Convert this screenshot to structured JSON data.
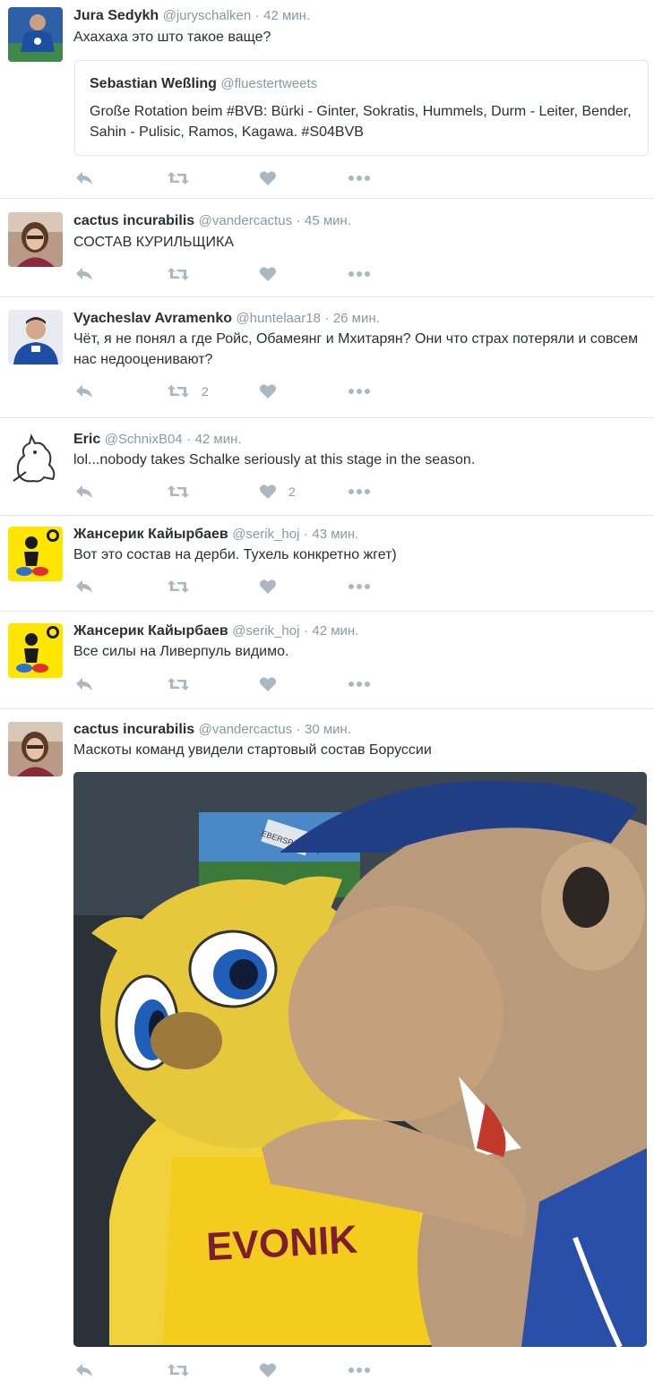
{
  "tweets": [
    {
      "fullname": "Jura Sedykh",
      "handle": "@juryschalken",
      "sep": "·",
      "time": "42 мин.",
      "text": "Ахахаха это што такое ваще?",
      "quote": {
        "fullname": "Sebastian Weßling",
        "handle": "@fluestertweets",
        "text": "Große Rotation beim #BVB: Bürki - Ginter, Sokratis, Hummels, Durm - Leiter, Bender, Sahin - Pulisic, Ramos, Kagawa. #S04BVB"
      },
      "retweets": "",
      "likes": ""
    },
    {
      "fullname": "cactus incurabilis",
      "handle": "@vandercactus",
      "sep": "·",
      "time": "45 мин.",
      "text": "СОСТАВ КУРИЛЬЩИКА",
      "retweets": "",
      "likes": ""
    },
    {
      "fullname": "Vyacheslav Avramenko",
      "handle": "@huntelaar18",
      "sep": "·",
      "time": "26 мин.",
      "text": "Чёт, я не понял а где Ройс, Обамеянг и Мхитарян? Они что страх потеряли и совсем нас недооценивают?",
      "retweets": "2",
      "likes": ""
    },
    {
      "fullname": "Eric",
      "handle": "@SchnixB04",
      "sep": "·",
      "time": "42 мин.",
      "text": "lol...nobody takes Schalke seriously at this stage in the season.",
      "retweets": "",
      "likes": "2"
    },
    {
      "fullname": "Жансерик Кайырбаев",
      "handle": "@serik_hoj",
      "sep": "·",
      "time": "43 мин.",
      "text": "Вот это состав на дерби. Тухель конкретно жгет)",
      "retweets": "",
      "likes": ""
    },
    {
      "fullname": "Жансерик Кайырбаев",
      "handle": "@serik_hoj",
      "sep": "·",
      "time": "42 мин.",
      "text": "Все силы на Ливерпуль видимо.",
      "retweets": "",
      "likes": ""
    },
    {
      "fullname": "cactus incurabilis",
      "handle": "@vandercactus",
      "sep": "·",
      "time": "30 мин.",
      "text": "Маскоты команд увидели стартовый состав Боруссии",
      "media": {
        "sponsor_text": "EVONIK",
        "screen_text": "EBERSPÄCHER"
      },
      "retweets": "",
      "likes": ""
    }
  ],
  "icons": {
    "reply": "reply-icon",
    "retweet": "retweet-icon",
    "like": "heart-icon",
    "more": "more-icon"
  },
  "colors": {
    "text": "#292f33",
    "muted": "#8899a6",
    "icon": "#aab8c2",
    "border": "#e1e8ed"
  }
}
